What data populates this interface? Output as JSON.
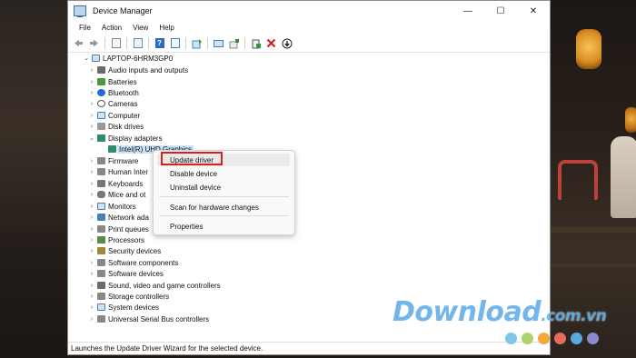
{
  "window": {
    "title": "Device Manager",
    "controls": {
      "minimize": "—",
      "maximize": "☐",
      "close": "✕"
    }
  },
  "menu": [
    "File",
    "Action",
    "View",
    "Help"
  ],
  "toolbar_icons": [
    "back-icon",
    "forward-icon",
    "properties-icon",
    "show-hidden-icon",
    "help-icon",
    "device-view-icon",
    "update-driver-icon",
    "scan-hardware-icon",
    "add-legacy-icon",
    "uninstall-icon",
    "disable-icon"
  ],
  "tree": {
    "root": "LAPTOP-6HRM3GP0",
    "categories": [
      {
        "label": "Audio inputs and outputs",
        "icon": "speaker-icon",
        "color": "#6a6a6a"
      },
      {
        "label": "Batteries",
        "icon": "battery-icon",
        "color": "#4a9a3a"
      },
      {
        "label": "Bluetooth",
        "icon": "bluetooth-icon",
        "color": "#1f6fd1"
      },
      {
        "label": "Cameras",
        "icon": "camera-icon",
        "color": "#555555"
      },
      {
        "label": "Computer",
        "icon": "computer-icon",
        "color": "#4a7fb0"
      },
      {
        "label": "Disk drives",
        "icon": "disk-icon",
        "color": "#777777"
      },
      {
        "label": "Display adapters",
        "icon": "display-adapter-icon",
        "color": "#2f8a6e"
      },
      {
        "label": "Intel(R) UHD Graphics",
        "icon": "graphics-card-icon",
        "color": "#2f8a6e"
      },
      {
        "label": "Firmware",
        "icon": "firmware-icon",
        "color": "#777777"
      },
      {
        "label": "Human Inter",
        "icon": "hid-icon",
        "color": "#777777"
      },
      {
        "label": "Keyboards",
        "icon": "keyboard-icon",
        "color": "#777777"
      },
      {
        "label": "Mice and ot",
        "icon": "mouse-icon",
        "color": "#777777"
      },
      {
        "label": "Monitors",
        "icon": "monitor-icon",
        "color": "#4a7fb0"
      },
      {
        "label": "Network ada",
        "icon": "network-icon",
        "color": "#4a7fb0"
      },
      {
        "label": "Print queues",
        "icon": "printer-icon",
        "color": "#777777"
      },
      {
        "label": "Processors",
        "icon": "processor-icon",
        "color": "#5a8a4a"
      },
      {
        "label": "Security devices",
        "icon": "security-icon",
        "color": "#a08a3a"
      },
      {
        "label": "Software components",
        "icon": "software-icon",
        "color": "#777777"
      },
      {
        "label": "Software devices",
        "icon": "software-device-icon",
        "color": "#777777"
      },
      {
        "label": "Sound, video and game controllers",
        "icon": "sound-icon",
        "color": "#6a6a6a"
      },
      {
        "label": "Storage controllers",
        "icon": "storage-icon",
        "color": "#777777"
      },
      {
        "label": "System devices",
        "icon": "system-icon",
        "color": "#4a7fb0"
      },
      {
        "label": "Universal Serial Bus controllers",
        "icon": "usb-icon",
        "color": "#777777"
      }
    ]
  },
  "context_menu": {
    "items": [
      "Update driver",
      "Disable device",
      "Uninstall device",
      "Scan for hardware changes",
      "Properties"
    ],
    "highlight_color": "#d82020"
  },
  "status": "Launches the Update Driver Wizard for the selected device.",
  "watermark": {
    "main": "Download",
    "suffix": ".com.vn"
  },
  "watermark_dot_colors": [
    "#7ec8e3",
    "#a9d46b",
    "#f2a93b",
    "#e86a5a",
    "#5aa8e0",
    "#8a8ad0"
  ]
}
